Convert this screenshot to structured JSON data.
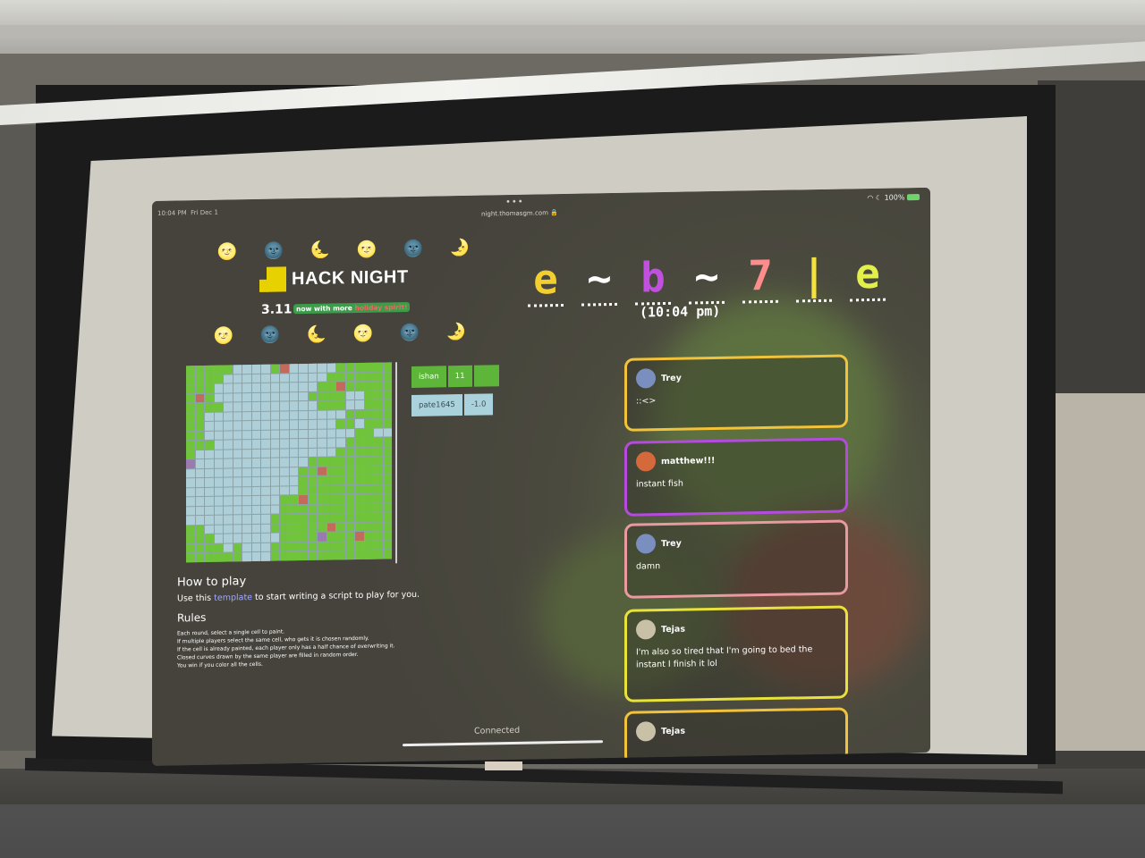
{
  "status": {
    "time": "10:04 PM",
    "date": "Fri Dec 1",
    "battery": "100%"
  },
  "browser": {
    "url": "night.thomasgm.com",
    "menu_dots": "•••"
  },
  "emoji_top": [
    "🌝",
    "🌚",
    "🌜",
    "🌝",
    "🌚",
    "🌛"
  ],
  "emoji_bottom": [
    "🌝",
    "🌚",
    "🌜",
    "🌝",
    "🌚",
    "🌛"
  ],
  "brand": {
    "name": "HACK NIGHT",
    "version": "3.11",
    "tagline_main": "now with more ",
    "tagline_accent": "holiday spirit!"
  },
  "puzzle": {
    "letters": [
      "e",
      "~",
      "b",
      "~",
      "7",
      "|",
      "e"
    ],
    "colors": [
      "#f2cf2e",
      "#ffffff",
      "#c14fe0",
      "#ffffff",
      "#ff8c8c",
      "#f4e13a",
      "#e4f04a"
    ],
    "time": "(10:04 pm)"
  },
  "scores": [
    {
      "name": "ishan",
      "score": "11"
    },
    {
      "name": "pate1645",
      "score": "-1.0"
    }
  ],
  "howto": {
    "title": "How to play",
    "pre": "Use this ",
    "link": "template",
    "post": " to start writing a script to play for you."
  },
  "rules": {
    "title": "Rules",
    "items": [
      "Each round, select a single cell to paint.",
      "If multiple players select the same cell, who gets it is chosen randomly.",
      "If the cell is already painted, each player only has a half chance of overwriting it.",
      "Closed curves drawn by the same player are filled in random order.",
      "You win if you color all the cells."
    ]
  },
  "connection": "Connected",
  "chat": [
    {
      "user": "Trey",
      "text": "::<>",
      "color": "#f2c23a"
    },
    {
      "user": "matthew!!!",
      "text": "instant fish",
      "color": "#b44bde"
    },
    {
      "user": "Trey",
      "text": "damn",
      "color": "#e89aa0"
    },
    {
      "user": "Tejas",
      "text": "I'm also so tired that I'm going to bed the instant I finish it lol",
      "color": "#e8e23a"
    },
    {
      "user": "Tejas",
      "text": "",
      "color": "#f2c23a"
    }
  ]
}
